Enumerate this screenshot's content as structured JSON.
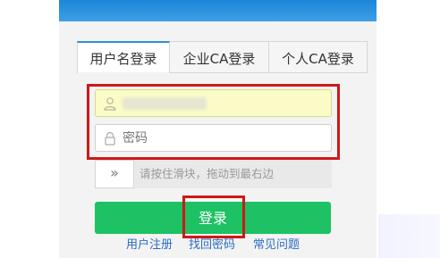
{
  "tabs": [
    {
      "label": "用户名登录",
      "active": true
    },
    {
      "label": "企业CA登录",
      "active": false
    },
    {
      "label": "个人CA登录",
      "active": false
    }
  ],
  "form": {
    "username_icon": "user-icon",
    "password_icon": "lock-icon",
    "password_placeholder": "密码",
    "slider_arrow": "»",
    "slider_text": "请按住滑块，拖动到最右边"
  },
  "login_button": {
    "label": "登录"
  },
  "links": {
    "register": "用户注册",
    "find_password": "找回密码",
    "faq": "常见问题"
  },
  "colors": {
    "accent_tab": "#2b8fd8",
    "login_green": "#1ec163",
    "highlight_red": "#d01818",
    "link_blue": "#2b6cc2",
    "username_fill": "#fbfbc7"
  }
}
